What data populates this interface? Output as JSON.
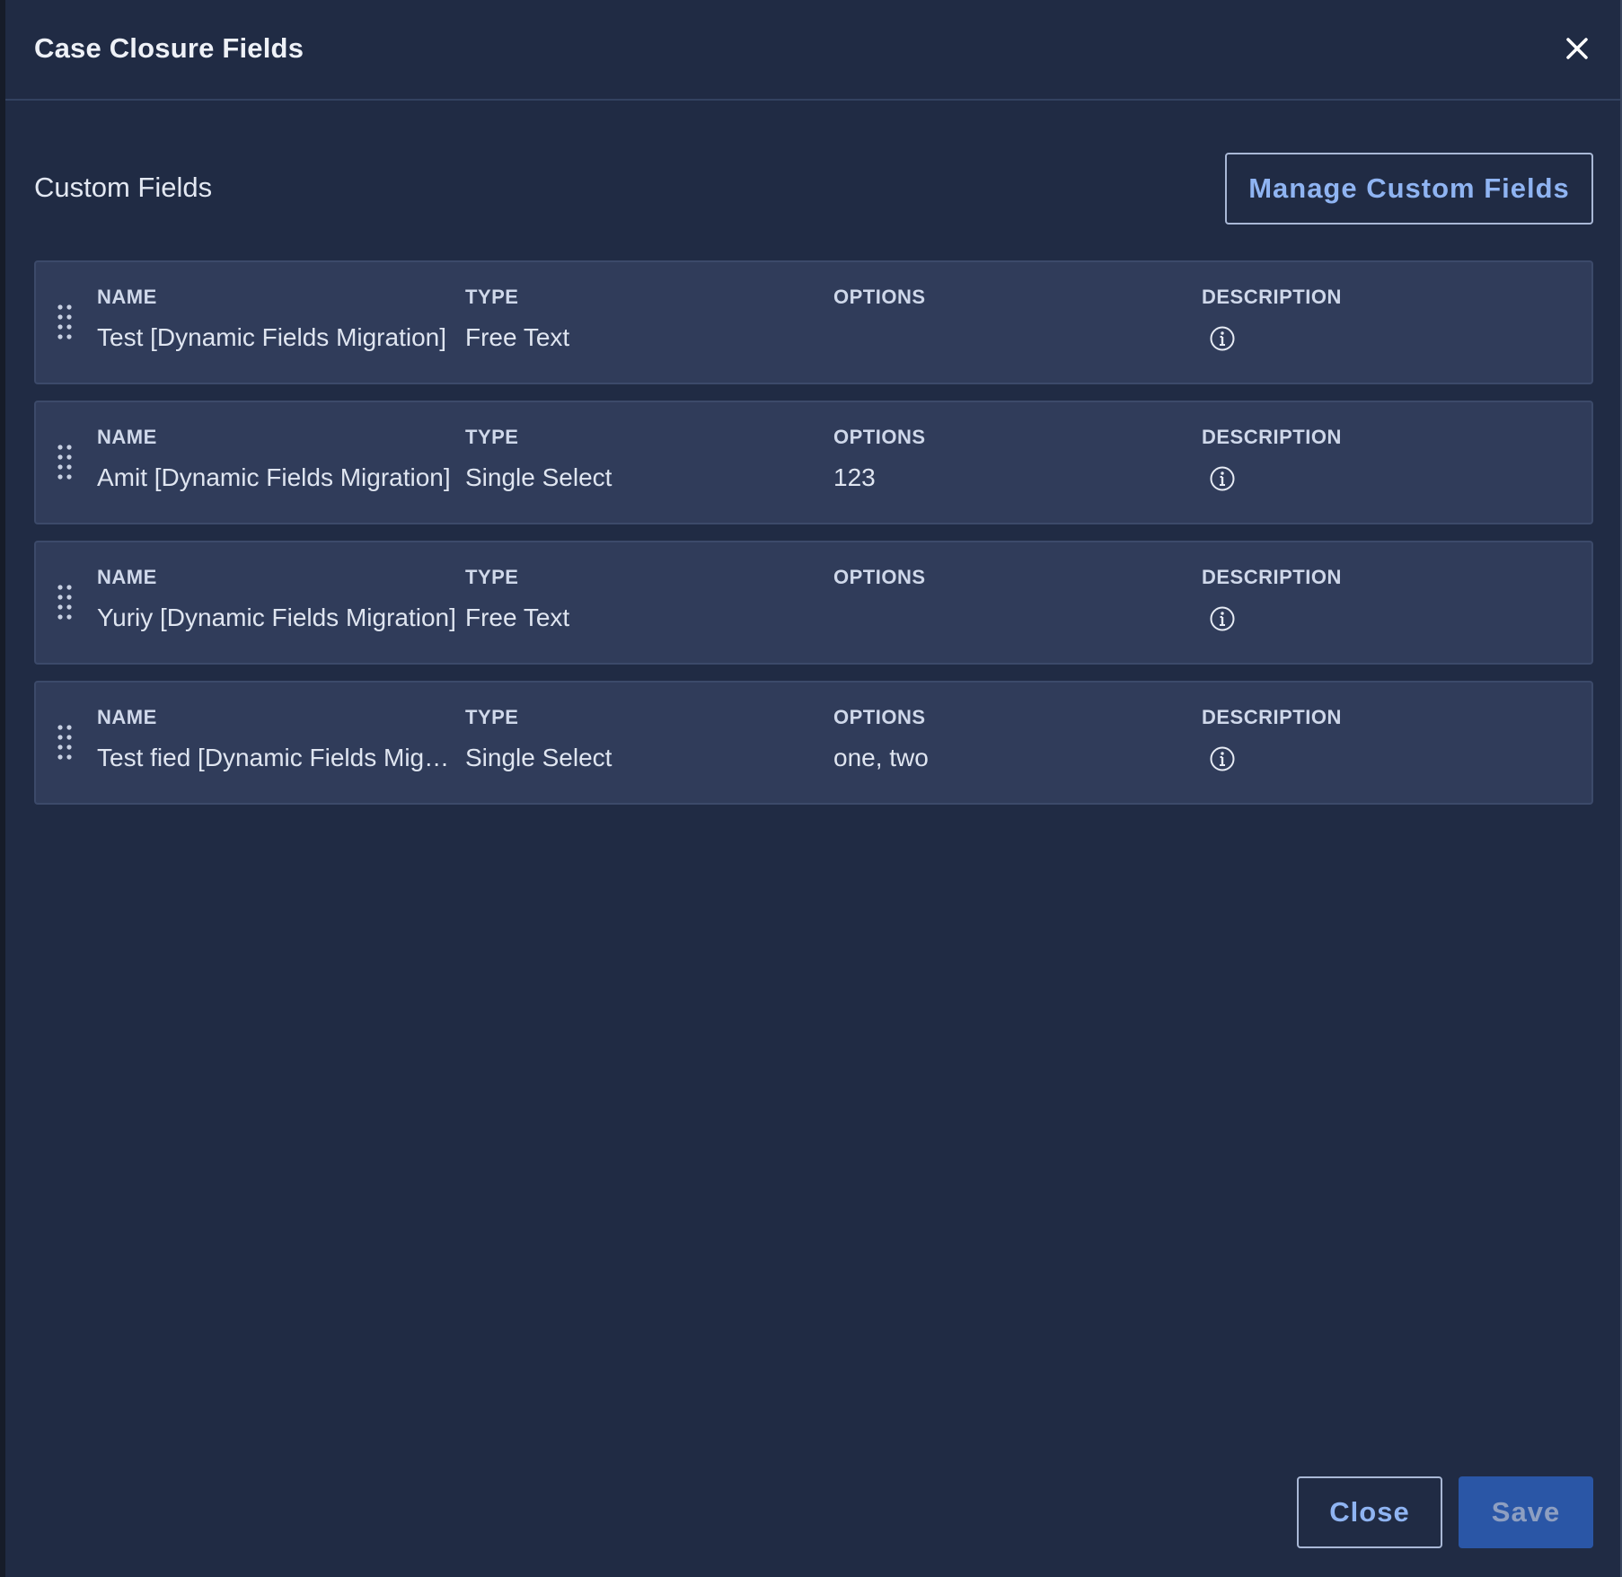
{
  "modal": {
    "title": "Case Closure Fields",
    "close_icon": "close-icon"
  },
  "section": {
    "title": "Custom Fields",
    "manage_button_label": "Manage Custom Fields"
  },
  "columns": {
    "name": "NAME",
    "type": "TYPE",
    "options": "OPTIONS",
    "description": "DESCRIPTION"
  },
  "fields": [
    {
      "name": "Test [Dynamic Fields Migration]",
      "type": "Free Text",
      "options": "",
      "description_icon": "info-icon"
    },
    {
      "name": "Amit [Dynamic Fields Migration]",
      "type": "Single Select",
      "options": "123",
      "description_icon": "info-icon"
    },
    {
      "name": "Yuriy [Dynamic Fields Migration]",
      "type": "Free Text",
      "options": "",
      "description_icon": "info-icon"
    },
    {
      "name": "Test fied [Dynamic Fields Migra…",
      "type": "Single Select",
      "options": "one, two",
      "description_icon": "info-icon"
    }
  ],
  "footer": {
    "close_label": "Close",
    "save_label": "Save"
  },
  "colors": {
    "background": "#202b44",
    "row_background": "#303c5a",
    "accent_text": "#8fb4f2",
    "save_button": "#2a56a6"
  }
}
